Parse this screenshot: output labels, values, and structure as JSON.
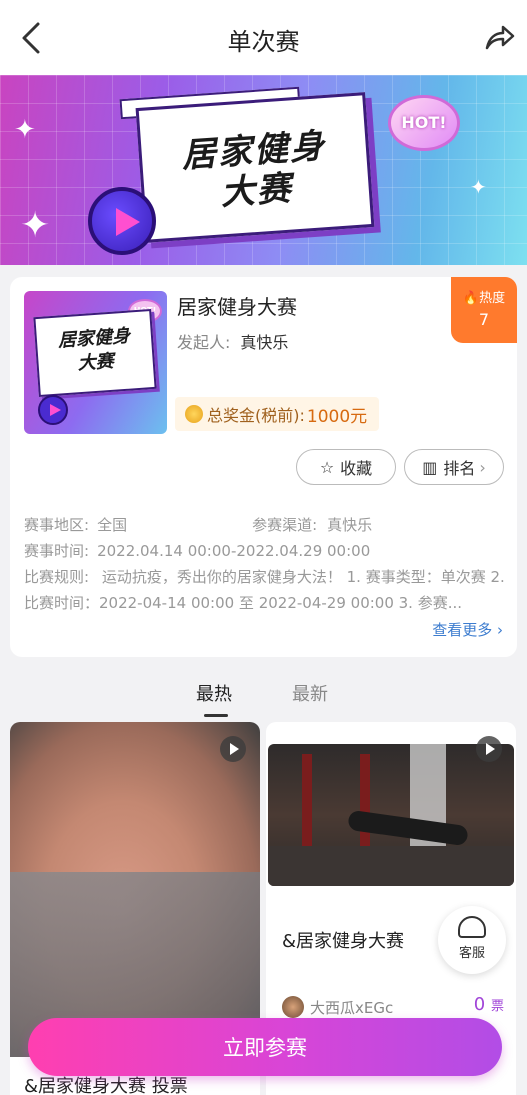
{
  "header": {
    "title": "单次赛"
  },
  "banner": {
    "title_line1": "居家健身",
    "title_line2": "大赛",
    "hot_badge": "HOT!"
  },
  "contest": {
    "thumb_text_line1": "居家健身",
    "thumb_text_line2": "大赛",
    "thumb_hot": "HOT!",
    "title": "居家健身大赛",
    "organizer_label": "发起人:",
    "organizer_name": "真快乐",
    "heat_label": "热度",
    "heat_value": "7",
    "prize_label": "总奖金(税前):",
    "prize_amount": "1000元",
    "favorite_label": "收藏",
    "rank_label": "排名",
    "region_label": "赛事地区:",
    "region_value": "全国",
    "channel_label": "参赛渠道:",
    "channel_value": "真快乐",
    "time_label": "赛事时间:",
    "time_value": "2022.04.14 00:00-2022.04.29 00:00",
    "rules_label": "比赛规则:",
    "rules_value": "运动抗疫，秀出你的居家健身大法！ 1. 赛事类型：单次赛 2. 比赛时间：2022-04-14 00:00 至 2022-04-29 00:00 3. 参赛...",
    "more_label": "查看更多"
  },
  "tabs": {
    "hot": "最热",
    "new": "最新"
  },
  "feed": {
    "left_caption": "&居家健身大赛 投票",
    "right_caption": "&居家健身大赛",
    "right_author": "大西瓜xEGc",
    "right_votes": "0",
    "votes_unit": "票"
  },
  "service": {
    "label": "客服"
  },
  "join": {
    "label": "立即参赛"
  },
  "colors": {
    "accent_pink": "#ff3fb0",
    "accent_purple": "#b24de6",
    "heat_orange": "#ff7a2d",
    "link_blue": "#3c7ccf"
  }
}
